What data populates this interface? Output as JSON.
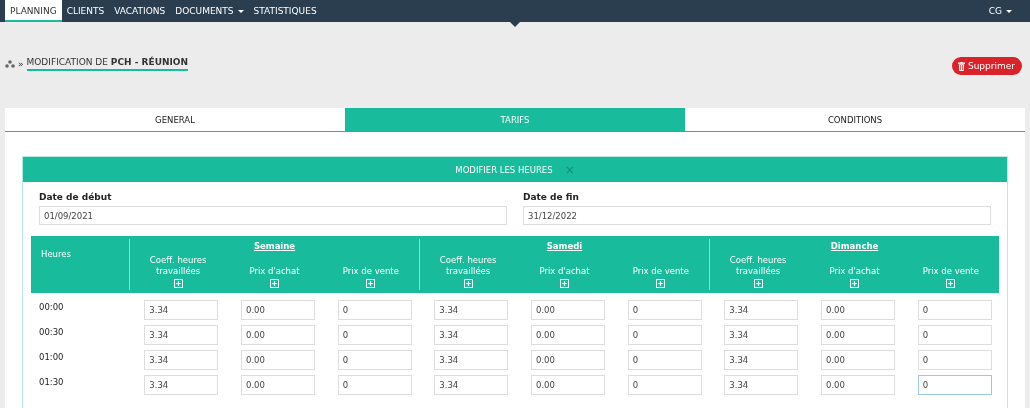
{
  "navbar": {
    "items": [
      {
        "label": "PLANNING",
        "selected": true,
        "dropdown": false
      },
      {
        "label": "CLIENTS",
        "selected": false,
        "dropdown": false
      },
      {
        "label": "VACATIONS",
        "selected": false,
        "dropdown": false
      },
      {
        "label": "DOCUMENTS",
        "selected": false,
        "dropdown": true
      },
      {
        "label": "STATISTIQUES",
        "selected": false,
        "dropdown": false
      }
    ],
    "user": {
      "label": "CG",
      "dropdown": true
    }
  },
  "breadcrumb": {
    "separator": "»",
    "title": "MODIFICATION DE **PCH - RÉUNION**"
  },
  "delete_button": {
    "label": "Supprimer"
  },
  "tabs": [
    {
      "label": "GENERAL",
      "selected": false
    },
    {
      "label": "TARIFS",
      "selected": true
    },
    {
      "label": "CONDITIONS",
      "selected": false
    }
  ],
  "card": {
    "title": "MODIFIER LES HEURES",
    "close": "×",
    "date_start": {
      "label": "Date de début",
      "value": "01/09/2021"
    },
    "date_end": {
      "label": "Date de fin",
      "value": "31/12/2022"
    },
    "table": {
      "first_column": "Heures",
      "groups": [
        {
          "name": "Semaine",
          "columns": [
            "Coeff. heures travaillées",
            "Prix d'achat",
            "Prix de vente"
          ]
        },
        {
          "name": "Samedi",
          "columns": [
            "Coeff. heures travaillées",
            "Prix d'achat",
            "Prix de vente"
          ]
        },
        {
          "name": "Dimanche",
          "columns": [
            "Coeff. heures travaillées",
            "Prix d'achat",
            "Prix de vente"
          ]
        }
      ],
      "rows": [
        {
          "time": "00:00",
          "cells": [
            {
              "value": "3.34",
              "focused": false
            },
            {
              "value": "0.00",
              "focused": false
            },
            {
              "value": "0",
              "focused": false
            },
            {
              "value": "3.34",
              "focused": false
            },
            {
              "value": "0.00",
              "focused": false
            },
            {
              "value": "0",
              "focused": false
            },
            {
              "value": "3.34",
              "focused": false
            },
            {
              "value": "0.00",
              "focused": false
            },
            {
              "value": "0",
              "focused": false
            }
          ]
        },
        {
          "time": "00:30",
          "cells": [
            {
              "value": "3.34",
              "focused": false
            },
            {
              "value": "0.00",
              "focused": false
            },
            {
              "value": "0",
              "focused": false
            },
            {
              "value": "3.34",
              "focused": false
            },
            {
              "value": "0.00",
              "focused": false
            },
            {
              "value": "0",
              "focused": false
            },
            {
              "value": "3.34",
              "focused": false
            },
            {
              "value": "0.00",
              "focused": false
            },
            {
              "value": "0",
              "focused": false
            }
          ]
        },
        {
          "time": "01:00",
          "cells": [
            {
              "value": "3.34",
              "focused": false
            },
            {
              "value": "0.00",
              "focused": false
            },
            {
              "value": "0",
              "focused": false
            },
            {
              "value": "3.34",
              "focused": false
            },
            {
              "value": "0.00",
              "focused": false
            },
            {
              "value": "0",
              "focused": false
            },
            {
              "value": "3.34",
              "focused": false
            },
            {
              "value": "0.00",
              "focused": false
            },
            {
              "value": "0",
              "focused": false
            }
          ]
        },
        {
          "time": "01:30",
          "cells": [
            {
              "value": "3.34",
              "focused": false
            },
            {
              "value": "0.00",
              "focused": false
            },
            {
              "value": "0",
              "focused": false
            },
            {
              "value": "3.34",
              "focused": false
            },
            {
              "value": "0.00",
              "focused": false
            },
            {
              "value": "0",
              "focused": false
            },
            {
              "value": "3.34",
              "focused": false
            },
            {
              "value": "0.00",
              "focused": false
            },
            {
              "value": "0",
              "focused": true
            }
          ]
        }
      ]
    }
  }
}
